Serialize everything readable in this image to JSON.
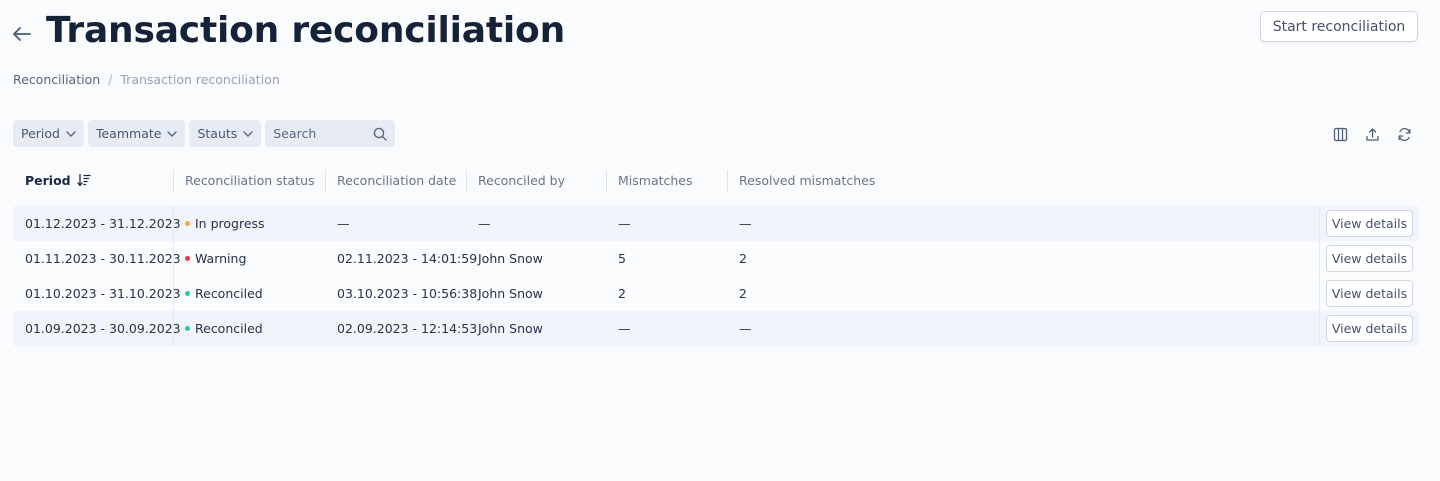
{
  "header": {
    "title": "Transaction reconciliation",
    "start_button": "Start reconciliation"
  },
  "breadcrumb": {
    "root": "Reconciliation",
    "separator": "/",
    "current": "Transaction reconciliation"
  },
  "filters": {
    "period": "Period",
    "teammate": "Teammate",
    "status": "Stauts",
    "search_placeholder": "Search"
  },
  "table": {
    "columns": [
      "Period",
      "Reconciliation status",
      "Reconciliation date",
      "Reconciled by",
      "Mismatches",
      "Resolved mismatches"
    ],
    "rows": [
      {
        "period": "01.12.2023 - 31.12.2023",
        "status": "In progress",
        "status_color": "#f0a93b",
        "date": "—",
        "by": "—",
        "mismatches": "—",
        "resolved": "—",
        "action": "View details"
      },
      {
        "period": "01.11.2023 - 30.11.2023",
        "status": "Warning",
        "status_color": "#e5413f",
        "date": "02.11.2023 - 14:01:59",
        "by": "John Snow",
        "mismatches": "5",
        "resolved": "2",
        "action": "View details"
      },
      {
        "period": "01.10.2023 - 31.10.2023",
        "status": "Reconciled",
        "status_color": "#2bc9a0",
        "date": "03.10.2023 - 10:56:38",
        "by": "John Snow",
        "mismatches": "2",
        "resolved": "2",
        "action": "View details"
      },
      {
        "period": "01.09.2023 - 30.09.2023",
        "status": "Reconciled",
        "status_color": "#2bc9a0",
        "date": "02.09.2023 - 12:14:53",
        "by": "John Snow",
        "mismatches": "—",
        "resolved": "—",
        "action": "View details"
      }
    ]
  },
  "icons": {
    "back": "arrow-left-icon",
    "sort": "sort-descending-icon",
    "chevron": "chevron-down-icon",
    "search": "search-icon",
    "columns": "columns-icon",
    "export": "upload-icon",
    "refresh": "refresh-icon"
  }
}
